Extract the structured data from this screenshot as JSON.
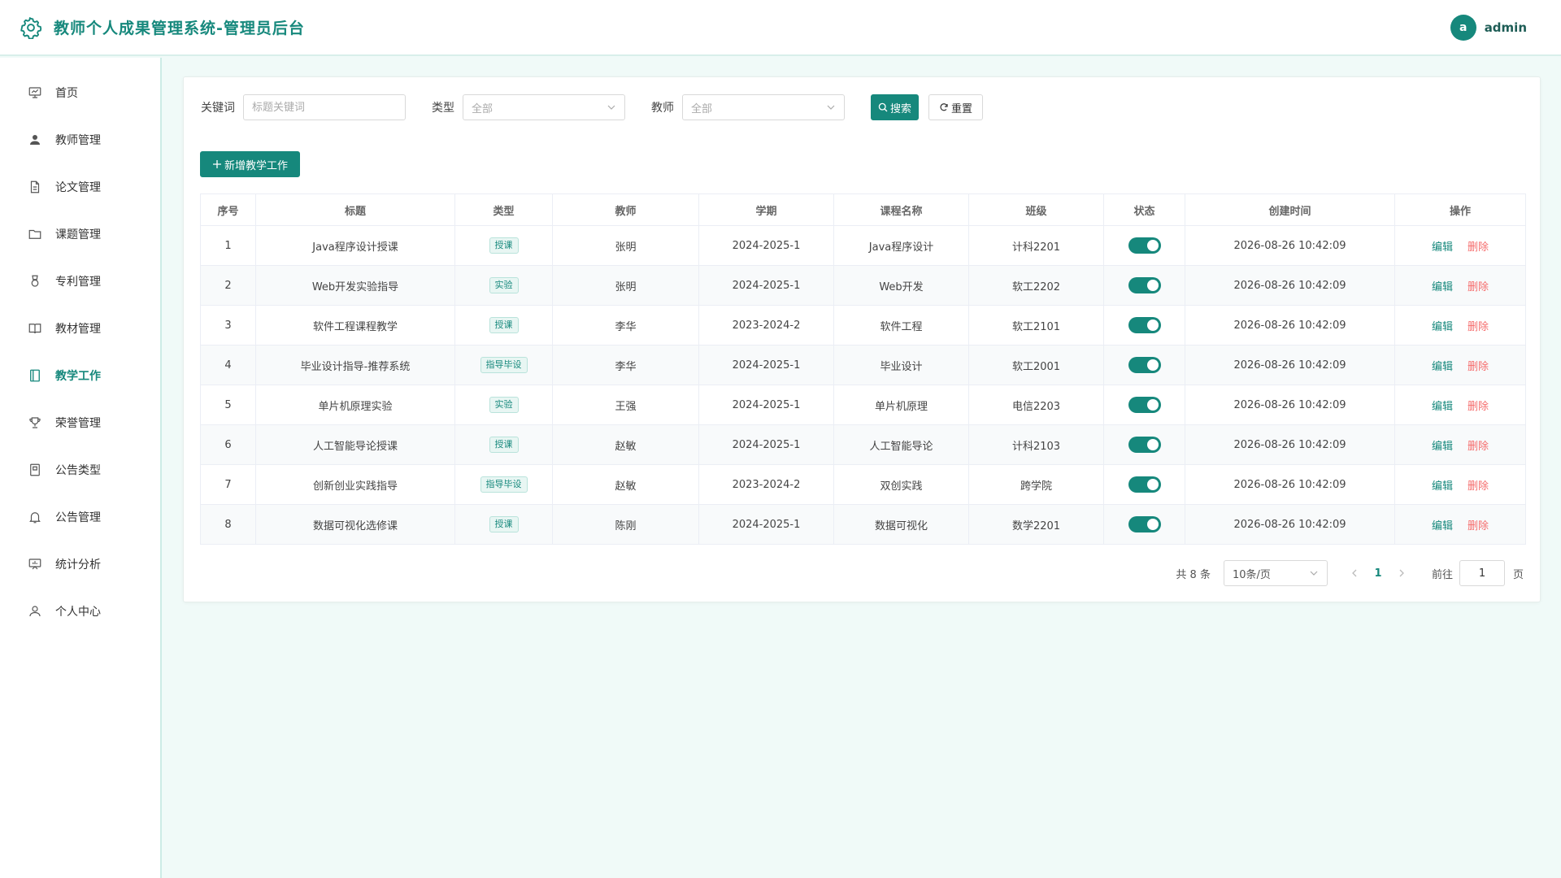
{
  "header": {
    "title": "教师个人成果管理系统-管理员后台",
    "user": {
      "avatar_letter": "a",
      "name": "admin"
    }
  },
  "sidebar": {
    "items": [
      {
        "label": "首页",
        "icon": "presentation-board-icon",
        "active": false
      },
      {
        "label": "教师管理",
        "icon": "user-solid-icon",
        "active": false
      },
      {
        "label": "论文管理",
        "icon": "document-icon",
        "active": false
      },
      {
        "label": "课题管理",
        "icon": "folder-icon",
        "active": false
      },
      {
        "label": "专利管理",
        "icon": "medal-icon",
        "active": false
      },
      {
        "label": "教材管理",
        "icon": "open-book-icon",
        "active": false
      },
      {
        "label": "教学工作",
        "icon": "notebook-icon",
        "active": true
      },
      {
        "label": "荣誉管理",
        "icon": "trophy-icon",
        "active": false
      },
      {
        "label": "公告类型",
        "icon": "notebook-list-icon",
        "active": false
      },
      {
        "label": "公告管理",
        "icon": "bell-icon",
        "active": false
      },
      {
        "label": "统计分析",
        "icon": "chart-board-icon",
        "active": false
      },
      {
        "label": "个人中心",
        "icon": "user-outline-icon",
        "active": false
      }
    ]
  },
  "filters": {
    "keyword_label": "关键词",
    "keyword_placeholder": "标题关键词",
    "type_label": "类型",
    "type_value": "全部",
    "teacher_label": "教师",
    "teacher_value": "全部",
    "search_label": "搜索",
    "reset_label": "重置"
  },
  "add_button": "新增教学工作",
  "table": {
    "columns": [
      "序号",
      "标题",
      "类型",
      "教师",
      "学期",
      "课程名称",
      "班级",
      "状态",
      "创建时间",
      "操作"
    ],
    "rows": [
      {
        "no": "1",
        "title": "Java程序设计授课",
        "type": "授课",
        "teacher": "张明",
        "term": "2024-2025-1",
        "course": "Java程序设计",
        "class": "计科2201",
        "enabled": true,
        "created": "2026-08-26 10:42:09"
      },
      {
        "no": "2",
        "title": "Web开发实验指导",
        "type": "实验",
        "teacher": "张明",
        "term": "2024-2025-1",
        "course": "Web开发",
        "class": "软工2202",
        "enabled": true,
        "created": "2026-08-26 10:42:09"
      },
      {
        "no": "3",
        "title": "软件工程课程教学",
        "type": "授课",
        "teacher": "李华",
        "term": "2023-2024-2",
        "course": "软件工程",
        "class": "软工2101",
        "enabled": true,
        "created": "2026-08-26 10:42:09"
      },
      {
        "no": "4",
        "title": "毕业设计指导-推荐系统",
        "type": "指导毕设",
        "teacher": "李华",
        "term": "2024-2025-1",
        "course": "毕业设计",
        "class": "软工2001",
        "enabled": true,
        "created": "2026-08-26 10:42:09"
      },
      {
        "no": "5",
        "title": "单片机原理实验",
        "type": "实验",
        "teacher": "王强",
        "term": "2024-2025-1",
        "course": "单片机原理",
        "class": "电信2203",
        "enabled": true,
        "created": "2026-08-26 10:42:09"
      },
      {
        "no": "6",
        "title": "人工智能导论授课",
        "type": "授课",
        "teacher": "赵敏",
        "term": "2024-2025-1",
        "course": "人工智能导论",
        "class": "计科2103",
        "enabled": true,
        "created": "2026-08-26 10:42:09"
      },
      {
        "no": "7",
        "title": "创新创业实践指导",
        "type": "指导毕设",
        "teacher": "赵敏",
        "term": "2023-2024-2",
        "course": "双创实践",
        "class": "跨学院",
        "enabled": true,
        "created": "2026-08-26 10:42:09"
      },
      {
        "no": "8",
        "title": "数据可视化选修课",
        "type": "授课",
        "teacher": "陈刚",
        "term": "2024-2025-1",
        "course": "数据可视化",
        "class": "数学2201",
        "enabled": true,
        "created": "2026-08-26 10:42:09"
      }
    ],
    "edit_label": "编辑",
    "delete_label": "删除"
  },
  "pagination": {
    "total_text": "共 8 条",
    "page_size": "10条/页",
    "current_page": "1",
    "goto_label": "前往",
    "goto_value": "1",
    "page_unit": "页"
  },
  "colors": {
    "accent": "#16887c",
    "danger": "#f56c6c",
    "background": "#f0faf8"
  }
}
